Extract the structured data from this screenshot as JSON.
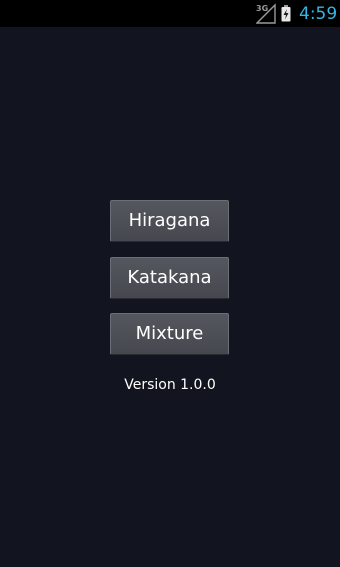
{
  "status_bar": {
    "network_type": "3G",
    "signal_icon": "cell-signal-icon",
    "battery_icon": "battery-charging-icon",
    "time": "4:59",
    "time_color": "#33b5e5"
  },
  "main": {
    "buttons": [
      {
        "label": "Hiragana"
      },
      {
        "label": "Katakana"
      },
      {
        "label": "Mixture"
      }
    ],
    "version": "Version 1.0.0"
  },
  "colors": {
    "background": "#12151f",
    "button": "#4e5057",
    "text": "#ffffff"
  }
}
